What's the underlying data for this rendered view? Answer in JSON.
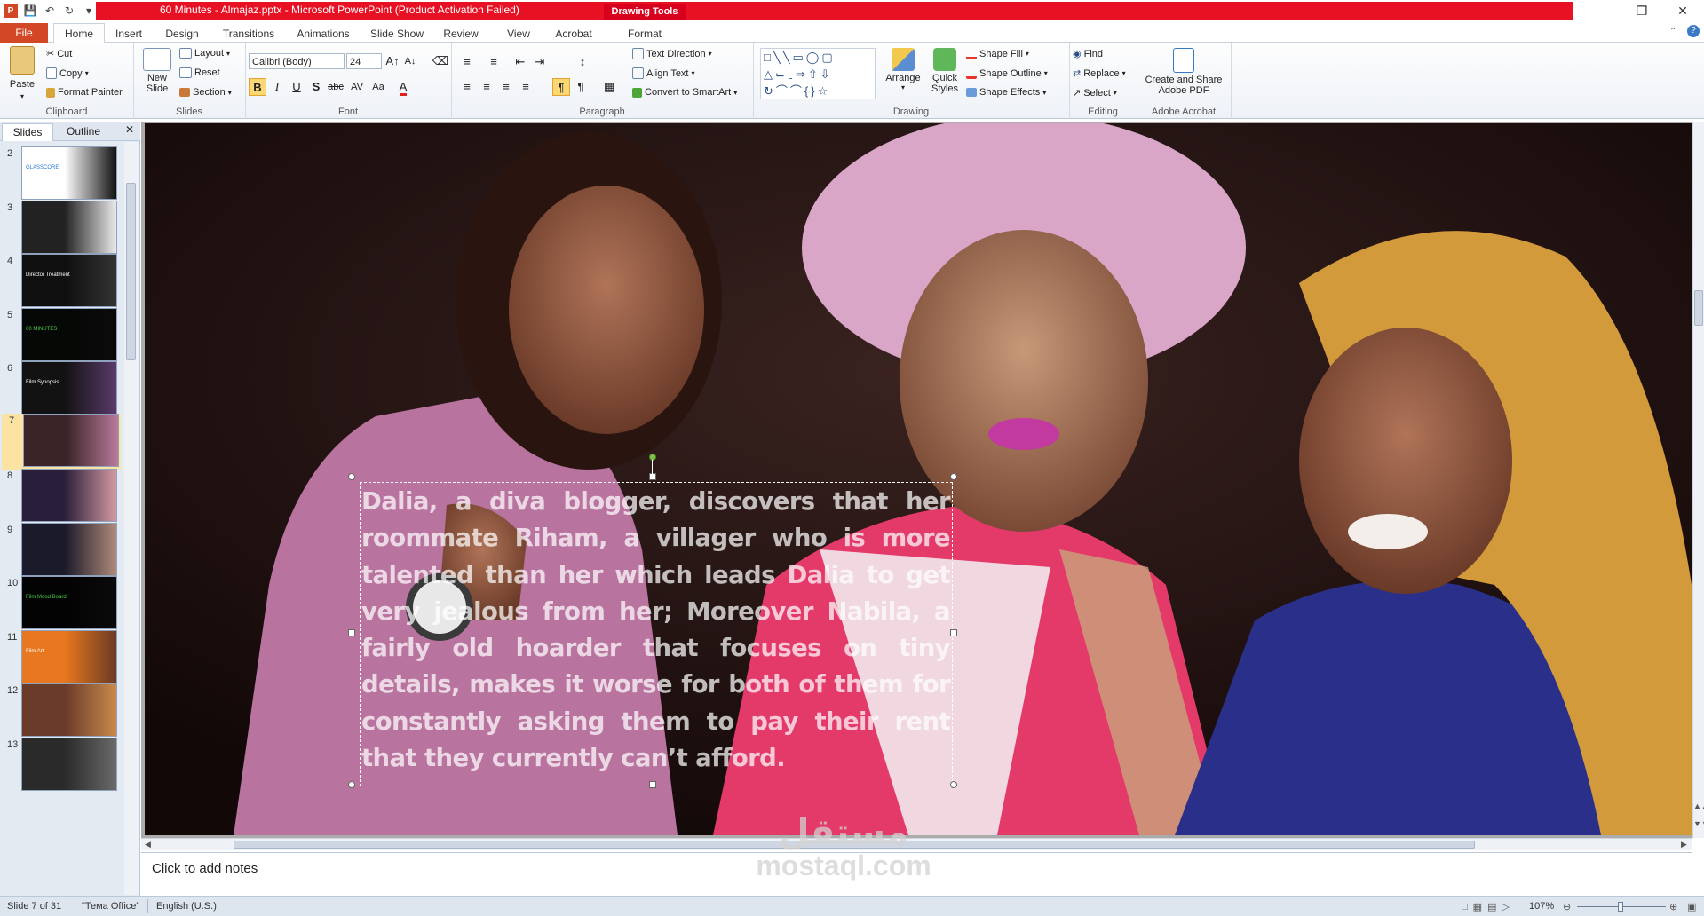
{
  "window": {
    "doc_title": "60 Minutes - Almajaz.pptx  -  Microsoft PowerPoint (Product Activation Failed)",
    "context_tab": "Drawing Tools",
    "colors": {
      "title_bar": "#e81123",
      "file_tab": "#d24726"
    }
  },
  "tabs": [
    "File",
    "Home",
    "Insert",
    "Design",
    "Transitions",
    "Animations",
    "Slide Show",
    "Review",
    "View",
    "Acrobat",
    "Format"
  ],
  "ribbon": {
    "clipboard": {
      "paste": "Paste",
      "cut": "Cut",
      "copy": "Copy",
      "format_painter": "Format Painter",
      "label": "Clipboard"
    },
    "slides": {
      "new_slide_1": "New",
      "new_slide_2": "Slide",
      "layout": "Layout",
      "reset": "Reset",
      "section": "Section",
      "label": "Slides"
    },
    "font": {
      "name": "Calibri (Body)",
      "size": "24",
      "label": "Font"
    },
    "paragraph": {
      "text_direction": "Text Direction",
      "align_text": "Align Text",
      "convert_smartart": "Convert to SmartArt",
      "label": "Paragraph"
    },
    "drawing": {
      "arrange": "Arrange",
      "quick_styles_1": "Quick",
      "quick_styles_2": "Styles",
      "shape_fill": "Shape Fill",
      "shape_outline": "Shape Outline",
      "shape_effects": "Shape Effects",
      "label": "Drawing"
    },
    "editing": {
      "find": "Find",
      "replace": "Replace",
      "select": "Select",
      "label": "Editing"
    },
    "acrobat": {
      "create_1": "Create and Share",
      "create_2": "Adobe PDF",
      "label": "Adobe Acrobat"
    }
  },
  "panel": {
    "tabs": [
      "Slides",
      "Outline"
    ],
    "thumbnails": [
      {
        "num": "2",
        "caption": "GLASSCORE"
      },
      {
        "num": "3",
        "caption": ""
      },
      {
        "num": "4",
        "caption": "Director Treatment"
      },
      {
        "num": "5",
        "caption": "60 MINUTES"
      },
      {
        "num": "6",
        "caption": "Film Synopsis"
      },
      {
        "num": "7",
        "caption": ""
      },
      {
        "num": "8",
        "caption": ""
      },
      {
        "num": "9",
        "caption": ""
      },
      {
        "num": "10",
        "caption": "Film Mood Board"
      },
      {
        "num": "11",
        "caption": "Film Art"
      },
      {
        "num": "12",
        "caption": ""
      },
      {
        "num": "13",
        "caption": ""
      }
    ],
    "selected": "7"
  },
  "slide": {
    "text": "Dalia, a diva blogger, discovers that her roommate Riham, a villager who is more talented than her which leads Dalia to get very jealous from her; Moreover Nabila, a fairly old hoarder that focuses on tiny details, makes it worse for both of them for constantly asking them to pay their rent that they currently can’t afford."
  },
  "notes": {
    "placeholder": "Click to add notes"
  },
  "watermark": {
    "arabic": "مستقل",
    "latin": "mostaql.com"
  },
  "status": {
    "slide": "Slide 7 of 31",
    "theme": "\"Тема Office\"",
    "language": "English (U.S.)",
    "zoom": "107%"
  }
}
